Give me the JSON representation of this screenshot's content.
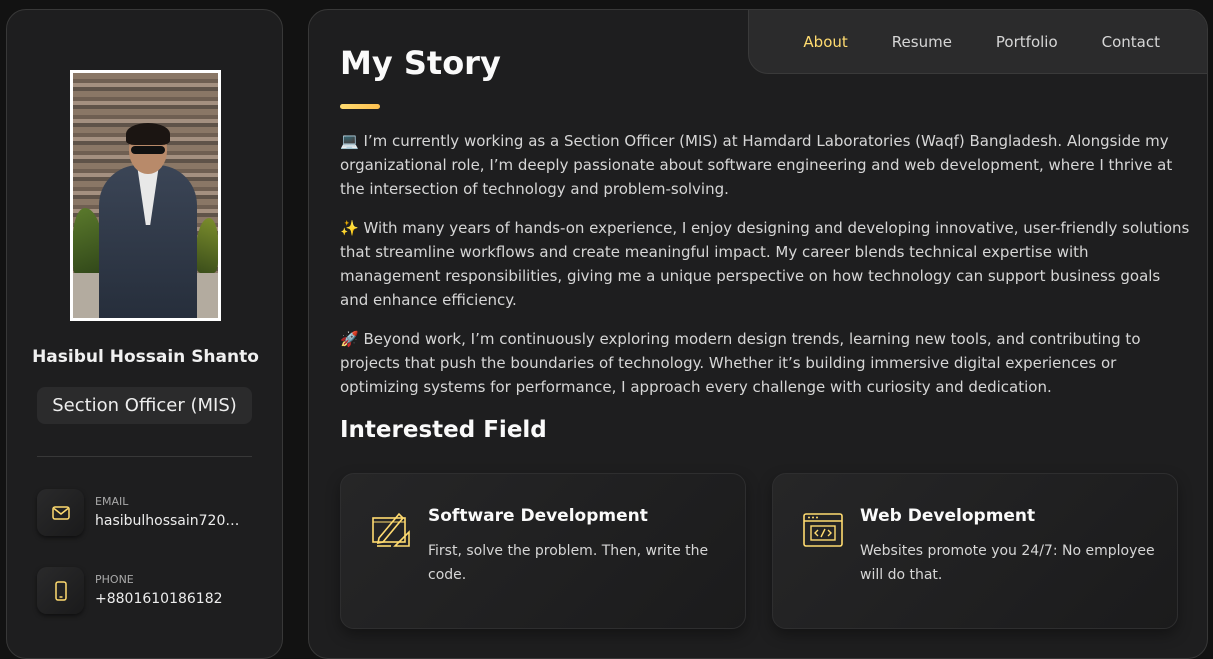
{
  "profile": {
    "name": "Hasibul Hossain Shanto",
    "role": "Section Officer (MIS)"
  },
  "contacts": [
    {
      "label": "EMAIL",
      "value": "hasibulhossain720@...",
      "icon": "mail-icon"
    },
    {
      "label": "PHONE",
      "value": "+8801610186182",
      "icon": "phone-icon"
    }
  ],
  "nav": {
    "items": [
      "About",
      "Resume",
      "Portfolio",
      "Contact"
    ],
    "active": "About"
  },
  "about": {
    "title": "My Story",
    "paragraphs": [
      "💻 I’m currently working as a Section Officer (MIS) at Hamdard Laboratories (Waqf) Bangladesh. Alongside my organizational role, I’m deeply passionate about software engineering and web development, where I thrive at the intersection of technology and problem-solving.",
      "✨ With many years of hands-on experience, I enjoy designing and developing innovative, user-friendly solutions that streamline workflows and create meaningful impact. My career blends technical expertise with management responsibilities, giving me a unique perspective on how technology can support business goals and enhance efficiency.",
      "🚀 Beyond work, I’m continuously exploring modern design trends, learning new tools, and contributing to projects that push the boundaries of technology. Whether it’s building immersive digital experiences or optimizing systems for performance, I approach every challenge with curiosity and dedication."
    ],
    "interested_title": "Interested Field",
    "fields": [
      {
        "title": "Software Development",
        "text": "First, solve the problem. Then, write the code.",
        "icon": "design-tools-icon"
      },
      {
        "title": "Web Development",
        "text": "Websites promote you 24/7: No employee will do that.",
        "icon": "browser-code-icon"
      }
    ]
  },
  "colors": {
    "accent": "#ffdb70",
    "background": "#121212",
    "panel": "#1e1e1f"
  }
}
